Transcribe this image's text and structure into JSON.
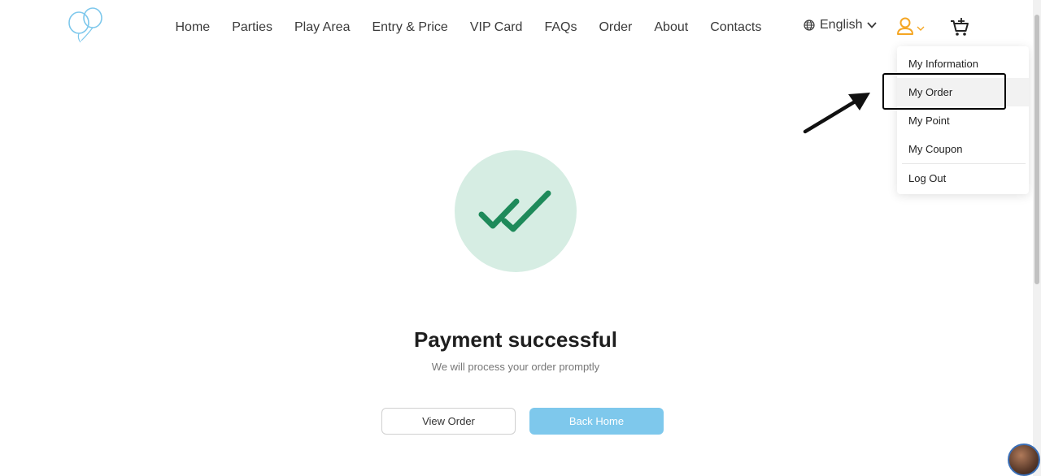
{
  "nav": {
    "items": [
      "Home",
      "Parties",
      "Play Area",
      "Entry & Price",
      "VIP Card",
      "FAQs",
      "Order",
      "About",
      "Contacts"
    ]
  },
  "header": {
    "language": "English"
  },
  "user_menu": {
    "items": [
      "My Information",
      "My Order",
      "My Point",
      "My Coupon",
      "Log Out"
    ]
  },
  "main": {
    "title": "Payment successful",
    "subtitle": "We will process your order promptly",
    "view_order_label": "View Order",
    "back_home_label": "Back Home"
  },
  "colors": {
    "accent": "#7ec8ec",
    "success_bg": "#d6ede3",
    "success_check": "#1e8a5a",
    "user_icon": "#f5a623"
  },
  "icons": [
    "balloon-logo-icon",
    "globe-icon",
    "chevron-down-icon",
    "user-icon",
    "cart-icon",
    "double-check-icon",
    "arrow-annotation"
  ]
}
